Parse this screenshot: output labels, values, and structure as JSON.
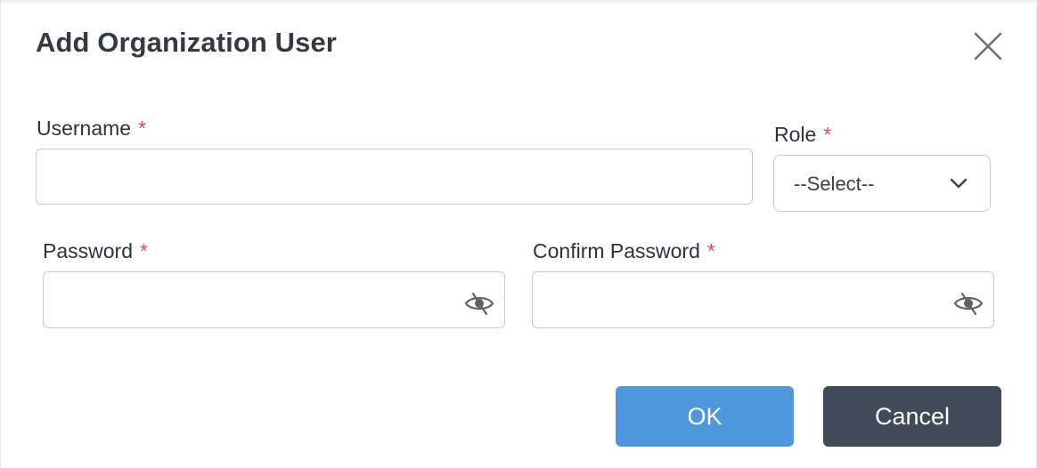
{
  "dialog": {
    "title": "Add Organization User",
    "close_icon": "close-icon"
  },
  "form": {
    "username": {
      "label": "Username",
      "required_marker": "*",
      "value": "",
      "placeholder": ""
    },
    "role": {
      "label": "Role",
      "required_marker": "*",
      "selected": "--Select--",
      "icon": "chevron-down-icon"
    },
    "password": {
      "label": "Password",
      "required_marker": "*",
      "value": "",
      "placeholder": "",
      "toggle_icon": "eye-slash-icon"
    },
    "confirm_password": {
      "label": "Confirm Password",
      "required_marker": "*",
      "value": "",
      "placeholder": "",
      "toggle_icon": "eye-slash-icon"
    }
  },
  "buttons": {
    "ok_label": "OK",
    "cancel_label": "Cancel"
  },
  "colors": {
    "required": "#e0495b",
    "ok_button": "#4f97dc",
    "cancel_button": "#404a58",
    "input_border": "#c7c9cc",
    "text": "#2f3338"
  }
}
